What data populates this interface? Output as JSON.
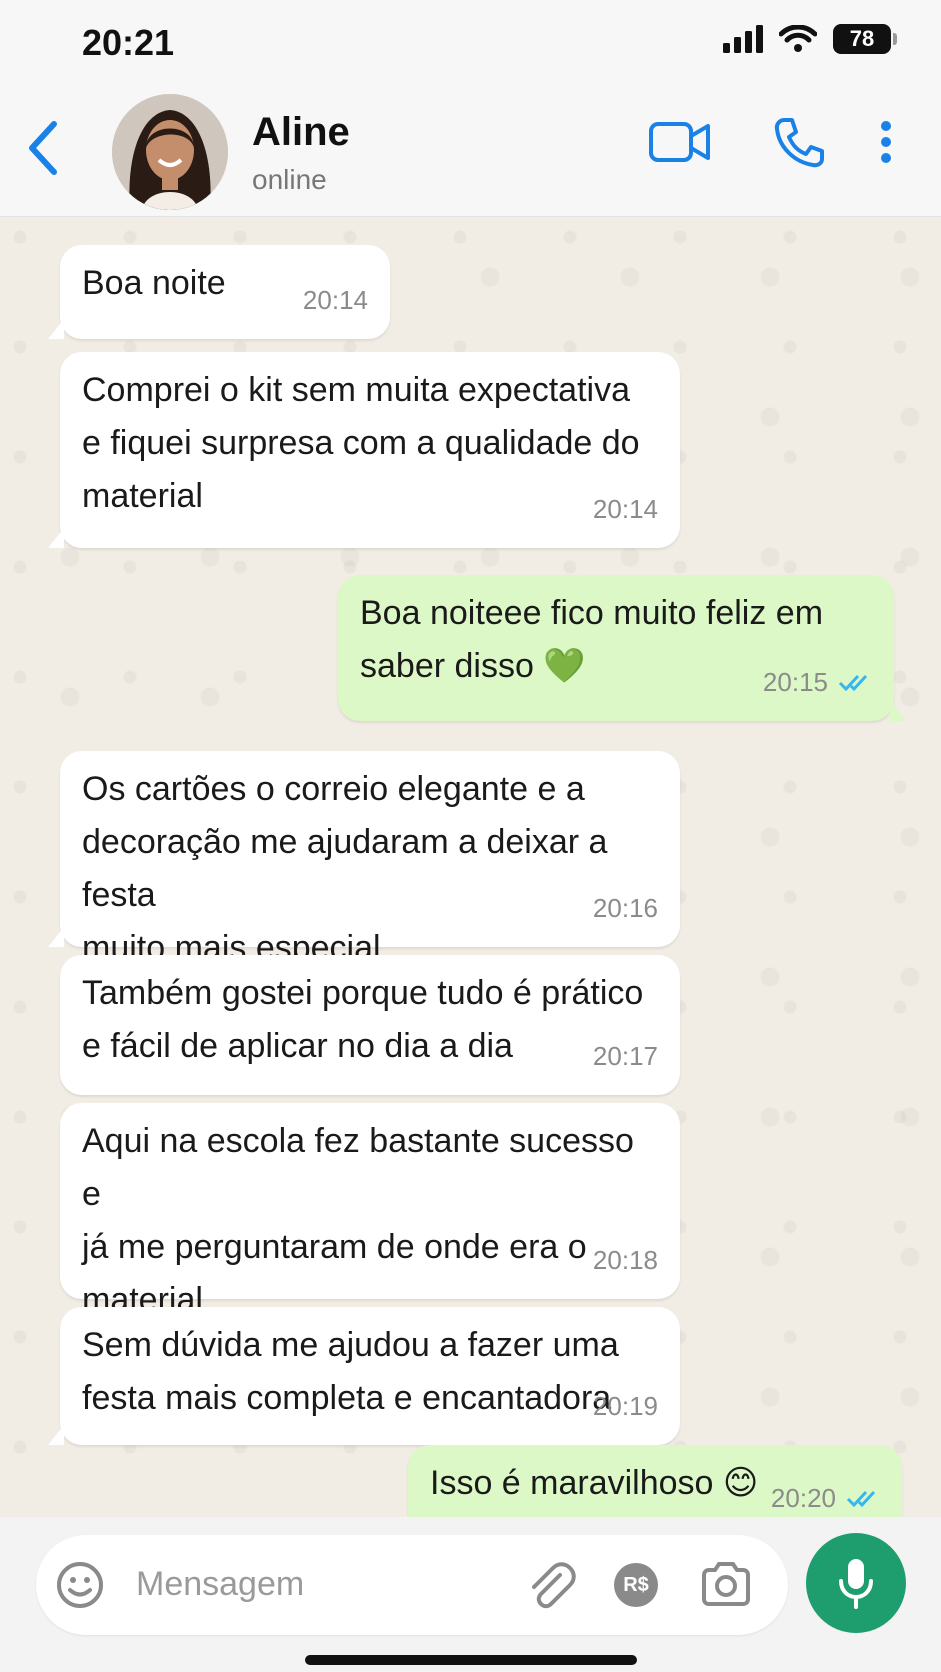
{
  "status_bar": {
    "time": "20:21",
    "battery": "78"
  },
  "header": {
    "contact_name": "Aline",
    "contact_status": "online",
    "icons": [
      "back-chevron-icon",
      "video-call-icon",
      "phone-icon",
      "more-vertical-icon"
    ]
  },
  "colors": {
    "accent": "#1a82e6",
    "outgoing_bubble": "#dcf8c6",
    "incoming_bubble": "#ffffff",
    "mic_button": "#1e9e6f",
    "read_ticks": "#34b7f1"
  },
  "messages": [
    {
      "direction": "in",
      "text": "Boa noite",
      "time": "20:14"
    },
    {
      "direction": "in",
      "text": "Comprei o kit sem muita expectativa\ne fiquei surpresa com a qualidade do\nmaterial",
      "time": "20:14"
    },
    {
      "direction": "out",
      "text": "Boa noiteee fico muito feliz em\nsaber disso",
      "emoji": "💚",
      "time": "20:15",
      "read": true
    },
    {
      "direction": "in",
      "text": "Os cartões o correio elegante e a\ndecoração me ajudaram a deixar a festa\nmuito mais especial",
      "time": "20:16"
    },
    {
      "direction": "in",
      "text": "Também gostei porque tudo é prático\ne fácil de aplicar no dia a dia",
      "time": "20:17"
    },
    {
      "direction": "in",
      "text": "Aqui na escola fez bastante sucesso e\njá me perguntaram de onde era o\nmaterial",
      "time": "20:18"
    },
    {
      "direction": "in",
      "text": "Sem dúvida me ajudou a fazer uma\nfesta mais completa e encantadora",
      "time": "20:19"
    },
    {
      "direction": "out",
      "text": "Isso é maravilhoso",
      "emoji": "😊",
      "time": "20:20",
      "read": true
    }
  ],
  "composer": {
    "placeholder": "Mensagem",
    "payment_label": "R$",
    "icons": [
      "emoji-icon",
      "paperclip-icon",
      "payment-icon",
      "camera-icon",
      "mic-icon"
    ]
  }
}
